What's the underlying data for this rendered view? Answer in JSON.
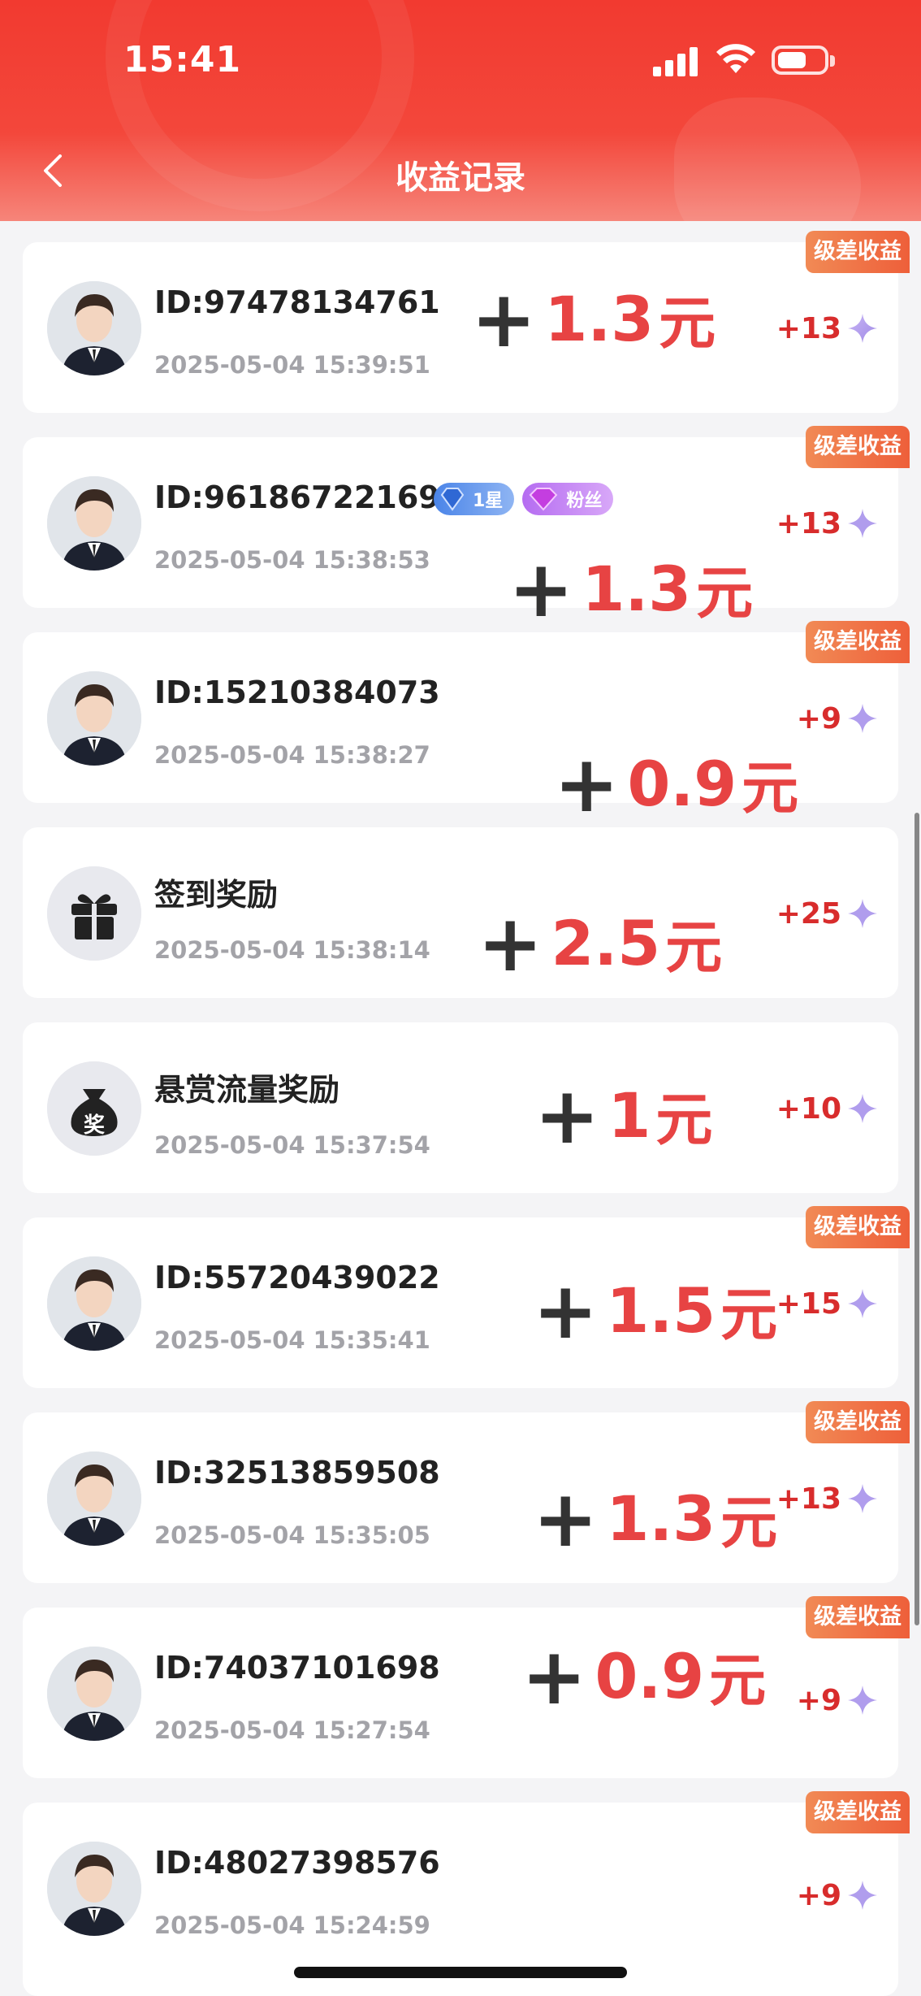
{
  "status_bar": {
    "time": "15:41"
  },
  "header": {
    "title": "收益记录"
  },
  "records": [
    {
      "id": "ID:97478134761",
      "time": "2025-05-04 15:39:51",
      "points": "+13",
      "tag": "级差收益",
      "amount_plus": "+",
      "amount_value": "1.3",
      "amount_unit": "元"
    },
    {
      "id": "ID:96186722169",
      "time": "2025-05-04 15:38:53",
      "points": "+13",
      "tag": "级差收益",
      "amount_plus": "+",
      "amount_value": "1.3",
      "amount_unit": "元",
      "badge_star": "1星",
      "badge_fan": "粉丝"
    },
    {
      "id": "ID:15210384073",
      "time": "2025-05-04 15:38:27",
      "points": "+9",
      "tag": "级差收益",
      "amount_plus": "+",
      "amount_value": "0.9",
      "amount_unit": "元"
    },
    {
      "id": "签到奖励",
      "time": "2025-05-04 15:38:14",
      "points": "+25",
      "amount_plus": "+",
      "amount_value": "2.5",
      "amount_unit": "元",
      "icon": "gift-icon"
    },
    {
      "id": "悬赏流量奖励",
      "time": "2025-05-04 15:37:54",
      "points": "+10",
      "amount_plus": "+",
      "amount_value": "1",
      "amount_unit": "元",
      "icon": "money-bag-icon",
      "icon_text": "奖"
    },
    {
      "id": "ID:55720439022",
      "time": "2025-05-04 15:35:41",
      "points": "+15",
      "tag": "级差收益",
      "amount_plus": "+",
      "amount_value": "1.5",
      "amount_unit": "元"
    },
    {
      "id": "ID:32513859508",
      "time": "2025-05-04 15:35:05",
      "points": "+13",
      "tag": "级差收益",
      "amount_plus": "+",
      "amount_value": "1.3",
      "amount_unit": "元"
    },
    {
      "id": "ID:74037101698",
      "time": "2025-05-04 15:27:54",
      "points": "+9",
      "tag": "级差收益",
      "amount_plus": "+",
      "amount_value": "0.9",
      "amount_unit": "元"
    },
    {
      "id": "ID:48027398576",
      "time": "2025-05-04 15:24:59",
      "points": "+9",
      "tag": "级差收益"
    }
  ],
  "colors": {
    "header_red": "#f23a30",
    "amount_red": "#e74343",
    "points_red": "#d82c2c",
    "tag_orange": "#ee5f3a"
  }
}
